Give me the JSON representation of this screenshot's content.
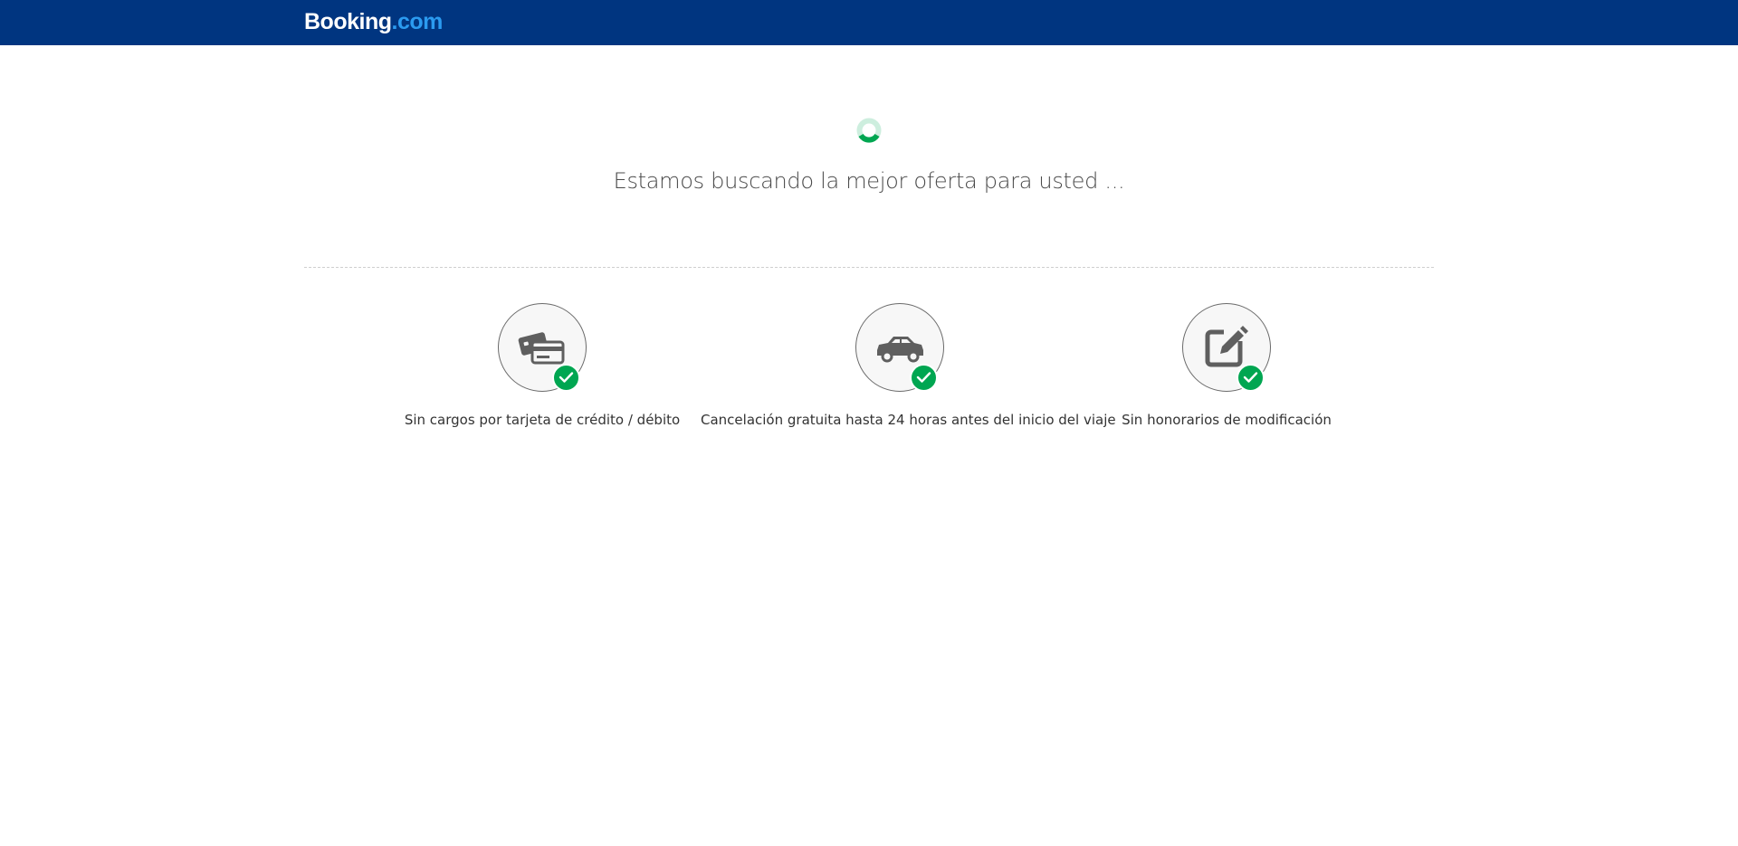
{
  "brand": {
    "logo_main": "Booking",
    "logo_tld": ".com",
    "header_color": "#003580",
    "accent_color": "#2b9bf0",
    "check_color": "#00a651"
  },
  "loading": {
    "message": "Estamos buscando la mejor oferta para usted ..."
  },
  "features": [
    {
      "icon": "credit-card-icon",
      "label": "Sin cargos por tarjeta de crédito / débito"
    },
    {
      "icon": "car-icon",
      "label": "Cancelación gratuita hasta 24 horas antes del inicio del viaje"
    },
    {
      "icon": "edit-icon",
      "label": "Sin honorarios de modificación"
    }
  ]
}
